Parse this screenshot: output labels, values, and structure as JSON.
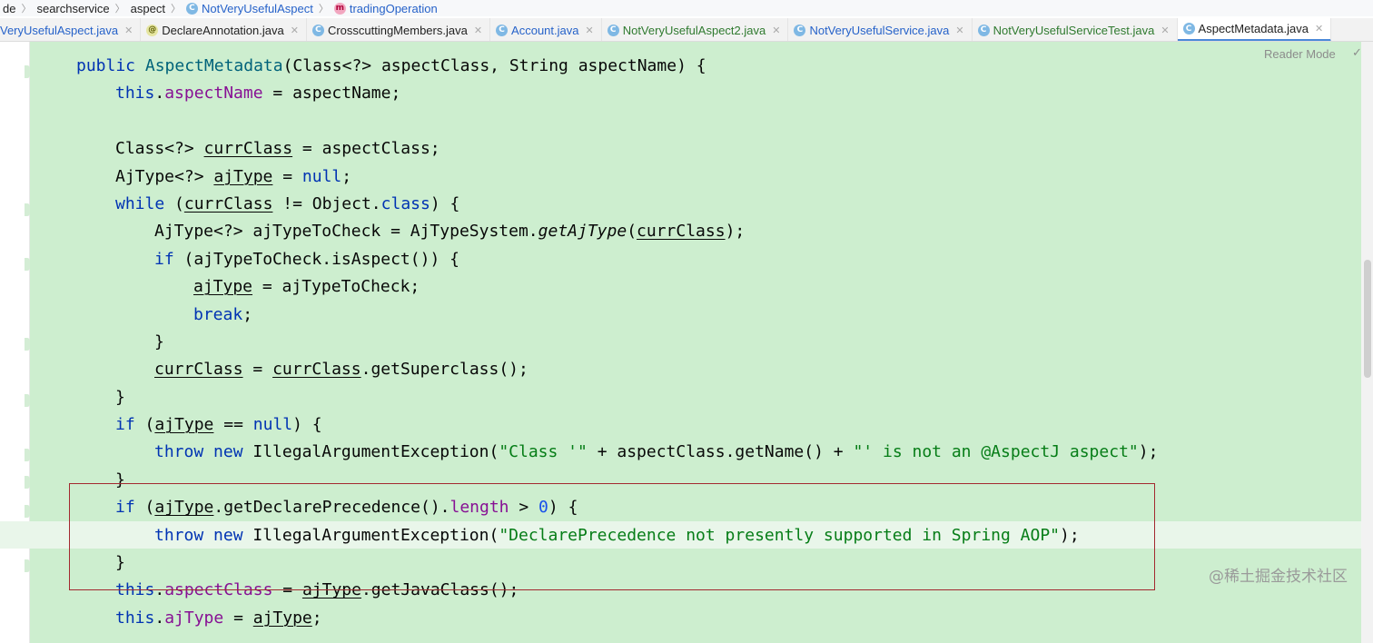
{
  "breadcrumb": {
    "items": [
      {
        "label": "de"
      },
      {
        "label": "searchservice"
      },
      {
        "label": "aspect"
      },
      {
        "label": "NotVeryUsefulAspect"
      },
      {
        "label": "tradingOperation"
      }
    ]
  },
  "tabs": [
    {
      "label": "VeryUsefulAspect.java"
    },
    {
      "label": "DeclareAnnotation.java"
    },
    {
      "label": "CrosscuttingMembers.java"
    },
    {
      "label": "Account.java"
    },
    {
      "label": "NotVeryUsefulAspect2.java"
    },
    {
      "label": "NotVeryUsefulService.java"
    },
    {
      "label": "NotVeryUsefulServiceTest.java"
    },
    {
      "label": "AspectMetadata.java"
    }
  ],
  "editor": {
    "reader_mode": "Reader Mode",
    "lines": [
      [
        "public",
        " ",
        "AspectMetadata",
        "(Class<?> aspectClass, String aspectName) {"
      ],
      [
        "this",
        ".",
        "aspectName",
        " = aspectName;"
      ],
      [
        ""
      ],
      [
        "Class<?> ",
        "currClass",
        " = aspectClass;"
      ],
      [
        "AjType<?> ",
        "ajType",
        " = ",
        "null",
        ";"
      ],
      [
        "while",
        " (",
        "currClass",
        " != Object.",
        "class",
        ") {"
      ],
      [
        "AjType<?> ajTypeToCheck = AjTypeSystem.",
        "getAjType",
        "(",
        "currClass",
        ");"
      ],
      [
        "if",
        " (ajTypeToCheck.isAspect()) {"
      ],
      [
        "ajType",
        " = ajTypeToCheck;"
      ],
      [
        "break",
        ";"
      ],
      [
        "}"
      ],
      [
        "currClass",
        " = ",
        "currClass",
        ".getSuperclass();"
      ],
      [
        "}"
      ],
      [
        "if",
        " (",
        "ajType",
        " == ",
        "null",
        ") {"
      ],
      [
        "throw",
        " ",
        "new",
        " IllegalArgumentException(",
        "\"Class '\"",
        " + aspectClass.getName() + ",
        "\"' is not an @AspectJ aspect\"",
        ");"
      ],
      [
        "}"
      ],
      [
        "if",
        " (",
        "ajType",
        ".getDeclarePrecedence().",
        "length",
        " > ",
        "0",
        ") {"
      ],
      [
        "throw",
        " ",
        "new",
        " IllegalArgumentException(",
        "\"DeclarePrecedence not presently supported in Spring AOP\"",
        ");"
      ],
      [
        "}"
      ],
      [
        "this",
        ".",
        "aspectClass",
        " = ",
        "ajType",
        ".getJavaClass();"
      ],
      [
        "this",
        ".",
        "ajType",
        " = ",
        "ajType",
        ";"
      ]
    ]
  },
  "watermark": "@稀土掘金技术社区"
}
